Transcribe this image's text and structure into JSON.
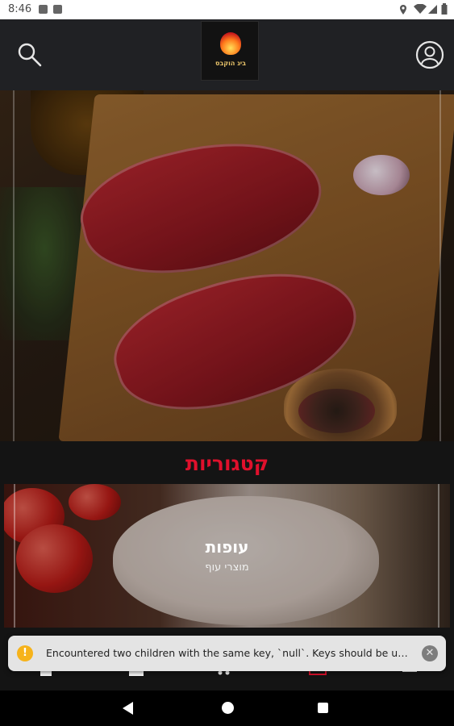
{
  "status_bar": {
    "time": "8:46"
  },
  "header": {
    "search_icon": "search-icon",
    "profile_icon": "user-profile-icon",
    "logo": {
      "name_text": "ביג הוקבס",
      "sub_text": ""
    }
  },
  "categories": {
    "title": "קטגוריות",
    "items": [
      {
        "name": "עופות",
        "subtitle": "מוצרי עוף"
      }
    ]
  },
  "toast": {
    "message": "Encountered two children with the same key, `null`. Keys should be unique so t...",
    "warn_glyph": "!",
    "close_glyph": "✕"
  },
  "colors": {
    "accent": "#e0102c",
    "header_bg": "#202124",
    "page_bg": "#141414"
  }
}
